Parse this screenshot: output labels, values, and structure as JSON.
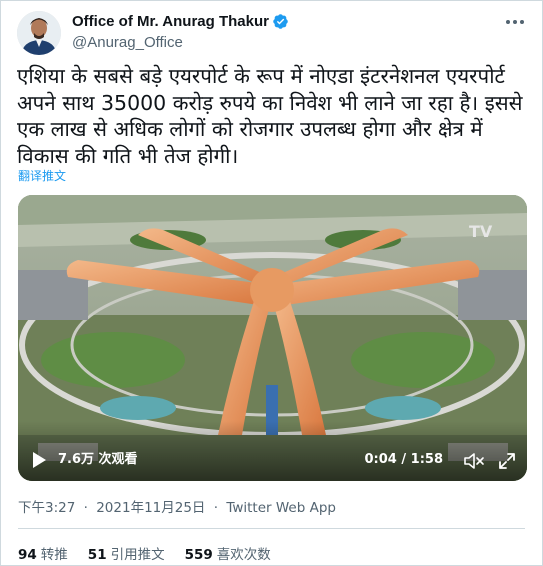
{
  "author": {
    "display_name": "Office of Mr. Anurag Thakur",
    "handle": "@Anurag_Office",
    "verified": true,
    "verified_color": "#1d9bf0"
  },
  "tweet": {
    "text": "एशिया के सबसे बड़े एयरपोर्ट के रूप में नोएडा इंटरनेशनल एयरपोर्ट अपने साथ 35000 करोड़ रुपये का निवेश भी लाने जा रहा है। इससे एक लाख से अधिक लोगों को रोजगार उपलब्ध होगा और क्षेत्र में विकास की गति भी तेज होगी।",
    "translate_label": "翻译推文"
  },
  "video": {
    "views": "7.6万 次观看",
    "time": "0:04 / 1:58",
    "play_icon": "play-icon",
    "mute_icon": "mute-icon",
    "fullscreen_icon": "fullscreen-icon"
  },
  "meta": {
    "time": "下午3:27",
    "separator": "·",
    "date": "2021年11月25日",
    "source": "Twitter Web App"
  },
  "stats": {
    "retweets_count": "94",
    "retweets_label": "转推",
    "quotes_count": "51",
    "quotes_label": "引用推文",
    "likes_count": "559",
    "likes_label": "喜欢次数"
  },
  "colors": {
    "link": "#1d9bf0",
    "secondary_text": "#536471",
    "border": "#cfd9de"
  }
}
